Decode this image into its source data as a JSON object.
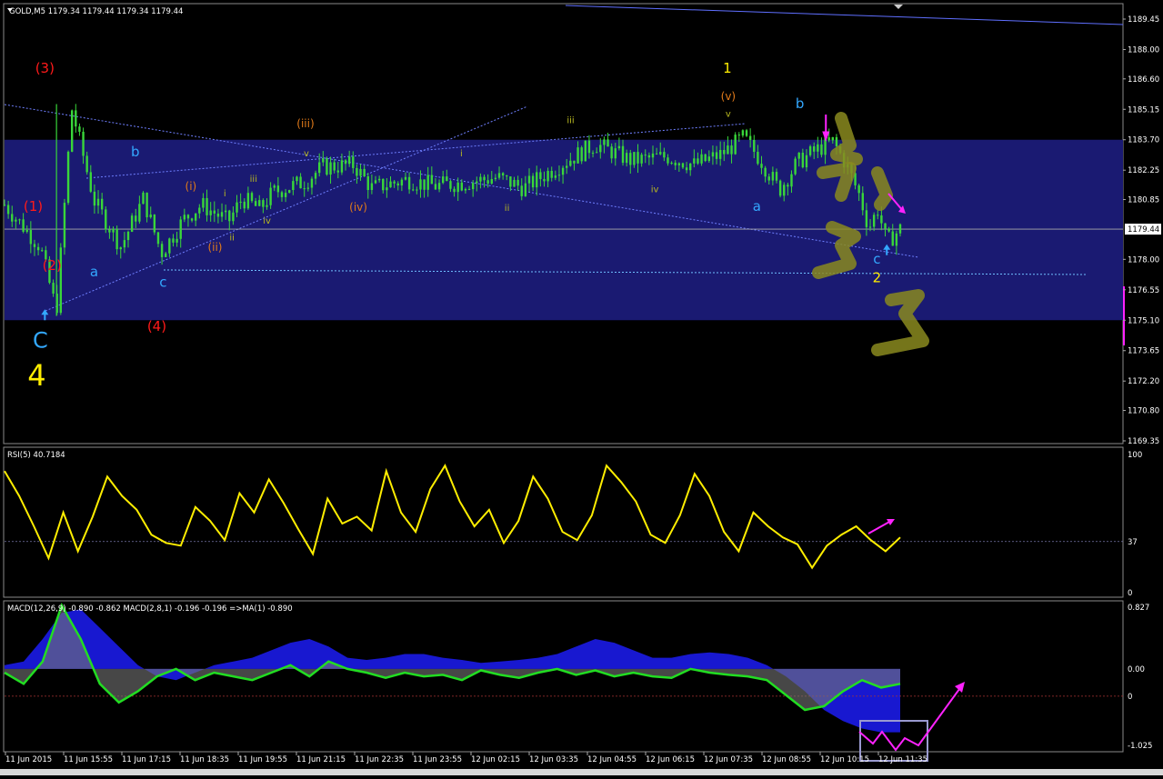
{
  "window": {
    "symbol_header": "GOLD,M5  1179.34 1179.44 1179.34 1179.44",
    "rsi_header": "RSI(5) 40.7184",
    "macd_header": "MACD(12,26,9) -0.890 -0.862  MACD(2,8,1) -0.196 -0.196  =>MA(1) -0.890"
  },
  "colors": {
    "background": "#000000",
    "zone": "#1a1a72",
    "candle": "#39d63a",
    "rsi": "#ffee00",
    "macd_hist": "#1818d0",
    "macd_hist_gray": "#777777",
    "macd_line": "#22dd22",
    "annotation_magenta": "#ff22ff",
    "label_red": "#ff1a1a",
    "label_cyan": "#33a8ff",
    "label_yellow": "#ffee00",
    "label_orange": "#e07a1a",
    "label_olive": "#b8b820"
  },
  "chart_data": [
    {
      "type": "candlestick",
      "title": "GOLD,M5",
      "y_ticks": [
        "1189.45",
        "1188.00",
        "1186.60",
        "1185.15",
        "1183.70",
        "1182.25",
        "1180.85",
        "1179.44",
        "1178.00",
        "1176.55",
        "1175.10",
        "1173.65",
        "1172.20",
        "1170.80",
        "1169.35"
      ],
      "ylim": [
        1169.35,
        1189.45
      ],
      "current_price": "1179.44",
      "zone": [
        1175.1,
        1183.7
      ],
      "close_path": [
        {
          "t": 0,
          "y": 1180.6
        },
        {
          "t": 0.04,
          "y": 1178.6
        },
        {
          "t": 0.058,
          "y": 1175.5
        },
        {
          "t": 0.075,
          "y": 1185.2
        },
        {
          "t": 0.1,
          "y": 1180.8
        },
        {
          "t": 0.13,
          "y": 1178.6
        },
        {
          "t": 0.155,
          "y": 1180.9
        },
        {
          "t": 0.175,
          "y": 1178.3
        },
        {
          "t": 0.2,
          "y": 1179.9
        },
        {
          "t": 0.22,
          "y": 1180.6
        },
        {
          "t": 0.25,
          "y": 1179.8
        },
        {
          "t": 0.265,
          "y": 1180.9
        },
        {
          "t": 0.285,
          "y": 1180.4
        },
        {
          "t": 0.3,
          "y": 1181.2
        },
        {
          "t": 0.335,
          "y": 1181.7
        },
        {
          "t": 0.355,
          "y": 1182.4
        },
        {
          "t": 0.39,
          "y": 1182.5
        },
        {
          "t": 0.41,
          "y": 1181.4
        },
        {
          "t": 0.45,
          "y": 1181.8
        },
        {
          "t": 0.48,
          "y": 1181.5
        },
        {
          "t": 0.52,
          "y": 1181.7
        },
        {
          "t": 0.55,
          "y": 1181.9
        },
        {
          "t": 0.58,
          "y": 1181.4
        },
        {
          "t": 0.62,
          "y": 1182.5
        },
        {
          "t": 0.66,
          "y": 1183.5
        },
        {
          "t": 0.7,
          "y": 1182.7
        },
        {
          "t": 0.74,
          "y": 1182.9
        },
        {
          "t": 0.77,
          "y": 1182.5
        },
        {
          "t": 0.8,
          "y": 1183.0
        },
        {
          "t": 0.825,
          "y": 1183.8
        },
        {
          "t": 0.845,
          "y": 1182.7
        },
        {
          "t": 0.865,
          "y": 1181.3
        },
        {
          "t": 0.885,
          "y": 1182.6
        },
        {
          "t": 0.91,
          "y": 1183.3
        },
        {
          "t": 0.925,
          "y": 1183.6
        },
        {
          "t": 0.94,
          "y": 1182.5
        },
        {
          "t": 0.955,
          "y": 1181.0
        },
        {
          "t": 0.965,
          "y": 1179.5
        },
        {
          "t": 0.975,
          "y": 1180.4
        },
        {
          "t": 0.985,
          "y": 1178.8
        },
        {
          "t": 1.0,
          "y": 1179.44
        }
      ],
      "elliott_labels": [
        {
          "text": "(3)",
          "t": 0.045,
          "price": 1186.9,
          "color": "label_red",
          "size": "wave-lbl"
        },
        {
          "text": "(1)",
          "t": 0.032,
          "price": 1180.3,
          "color": "label_red",
          "size": "wave-lbl"
        },
        {
          "text": "(2)",
          "t": 0.053,
          "price": 1177.5,
          "color": "label_red",
          "size": "wave-lbl"
        },
        {
          "text": "(4)",
          "t": 0.17,
          "price": 1174.6,
          "color": "label_red",
          "size": "wave-lbl"
        },
        {
          "text": "C",
          "t": 0.04,
          "price": 1173.8,
          "color": "label_cyan",
          "size": "wave-xl"
        },
        {
          "text": "4",
          "t": 0.036,
          "price": 1172.0,
          "color": "label_yellow",
          "size": "wave-xxl"
        },
        {
          "text": "b",
          "t": 0.146,
          "price": 1182.9,
          "color": "label_cyan",
          "size": "wave-lbl"
        },
        {
          "text": "a",
          "t": 0.1,
          "price": 1177.2,
          "color": "label_cyan",
          "size": "wave-lbl"
        },
        {
          "text": "c",
          "t": 0.177,
          "price": 1176.7,
          "color": "label_cyan",
          "size": "wave-lbl"
        },
        {
          "text": "(i)",
          "t": 0.208,
          "price": 1181.3,
          "color": "label_orange",
          "size": "wave-sm"
        },
        {
          "text": "(ii)",
          "t": 0.235,
          "price": 1178.4,
          "color": "label_orange",
          "size": "wave-sm"
        },
        {
          "text": "(iii)",
          "t": 0.336,
          "price": 1184.3,
          "color": "label_orange",
          "size": "wave-sm"
        },
        {
          "text": "(iv)",
          "t": 0.395,
          "price": 1180.3,
          "color": "label_orange",
          "size": "wave-sm"
        },
        {
          "text": "(v)",
          "t": 0.808,
          "price": 1185.6,
          "color": "label_orange",
          "size": "wave-sm"
        },
        {
          "text": "1",
          "t": 0.807,
          "price": 1186.9,
          "color": "label_yellow",
          "size": "wave-lbl"
        },
        {
          "text": "i",
          "t": 0.246,
          "price": 1181.0,
          "color": "label_olive",
          "size": "wave-xs"
        },
        {
          "text": "ii",
          "t": 0.254,
          "price": 1178.9,
          "color": "label_olive",
          "size": "wave-xs"
        },
        {
          "text": "iii",
          "t": 0.278,
          "price": 1181.7,
          "color": "label_olive",
          "size": "wave-xs"
        },
        {
          "text": "iv",
          "t": 0.293,
          "price": 1179.7,
          "color": "label_olive",
          "size": "wave-xs"
        },
        {
          "text": "v",
          "t": 0.337,
          "price": 1182.9,
          "color": "label_olive",
          "size": "wave-xs"
        },
        {
          "text": "i",
          "t": 0.51,
          "price": 1182.9,
          "color": "label_olive",
          "size": "wave-xs"
        },
        {
          "text": "ii",
          "t": 0.561,
          "price": 1180.3,
          "color": "label_olive",
          "size": "wave-xs"
        },
        {
          "text": "iii",
          "t": 0.632,
          "price": 1184.5,
          "color": "label_olive",
          "size": "wave-xs"
        },
        {
          "text": "iv",
          "t": 0.726,
          "price": 1181.2,
          "color": "label_olive",
          "size": "wave-xs"
        },
        {
          "text": "v",
          "t": 0.808,
          "price": 1184.8,
          "color": "label_olive",
          "size": "wave-xs"
        },
        {
          "text": "b",
          "t": 0.888,
          "price": 1185.2,
          "color": "label_cyan",
          "size": "wave-lbl"
        },
        {
          "text": "a",
          "t": 0.84,
          "price": 1180.3,
          "color": "label_cyan",
          "size": "wave-lbl"
        },
        {
          "text": "c",
          "t": 0.974,
          "price": 1177.8,
          "color": "label_cyan",
          "size": "wave-lbl"
        },
        {
          "text": "2",
          "t": 0.974,
          "price": 1176.9,
          "color": "label_yellow",
          "size": "wave-lbl"
        }
      ]
    },
    {
      "type": "line",
      "title": "RSI(5) 40.7184",
      "y_ticks": [
        "100",
        "37",
        "0"
      ],
      "ylim": [
        0,
        100
      ],
      "level": 37,
      "series": [
        {
          "values": [
            88,
            70,
            48,
            25,
            58,
            30,
            55,
            84,
            70,
            60,
            42,
            36,
            34,
            62,
            52,
            38,
            72,
            58,
            82,
            65,
            46,
            28,
            68,
            50,
            55,
            45,
            88,
            58,
            44,
            75,
            92,
            66,
            48,
            60,
            36,
            52,
            84,
            68,
            44,
            38,
            56,
            92,
            80,
            66,
            42,
            36,
            56,
            86,
            70,
            44,
            30,
            58,
            48,
            40,
            35,
            18,
            34,
            42,
            48,
            38,
            30,
            40
          ]
        }
      ]
    },
    {
      "type": "line",
      "title": "MACD(12,26,9) -0.890 -0.862  MACD(2,8,1) -0.196 -0.196  =>MA(1) -0.890",
      "y_ticks": [
        "0.827",
        "0.00",
        "0",
        "-1.025"
      ],
      "ylim": [
        -1.025,
        0.827
      ],
      "hist": [
        0.05,
        0.1,
        0.4,
        0.75,
        0.8,
        0.55,
        0.3,
        0.05,
        -0.1,
        -0.15,
        -0.05,
        0.05,
        0.1,
        0.15,
        0.25,
        0.35,
        0.4,
        0.3,
        0.15,
        0.12,
        0.15,
        0.2,
        0.2,
        0.15,
        0.12,
        0.08,
        0.1,
        0.12,
        0.15,
        0.2,
        0.3,
        0.4,
        0.35,
        0.25,
        0.15,
        0.15,
        0.2,
        0.22,
        0.2,
        0.15,
        0.05,
        -0.1,
        -0.3,
        -0.55,
        -0.7,
        -0.8,
        -0.85,
        -0.85
      ],
      "signal_line": [
        -0.05,
        -0.2,
        0.1,
        0.85,
        0.4,
        -0.2,
        -0.45,
        -0.3,
        -0.1,
        0.0,
        -0.15,
        -0.05,
        -0.1,
        -0.15,
        -0.05,
        0.05,
        -0.1,
        0.1,
        0.0,
        -0.05,
        -0.12,
        -0.05,
        -0.1,
        -0.08,
        -0.15,
        -0.02,
        -0.08,
        -0.12,
        -0.05,
        0.0,
        -0.08,
        -0.02,
        -0.1,
        -0.05,
        -0.1,
        -0.12,
        0.0,
        -0.05,
        -0.08,
        -0.1,
        -0.15,
        -0.35,
        -0.55,
        -0.5,
        -0.3,
        -0.15,
        -0.25,
        -0.2
      ]
    }
  ],
  "x_labels": [
    "11 Jun 2015",
    "11 Jun 15:55",
    "11 Jun 17:15",
    "11 Jun 18:35",
    "11 Jun 19:55",
    "11 Jun 21:15",
    "11 Jun 22:35",
    "11 Jun 23:55",
    "12 Jun 02:15",
    "12 Jun 03:35",
    "12 Jun 04:55",
    "12 Jun 06:15",
    "12 Jun 07:35",
    "12 Jun 08:55",
    "12 Jun 10:15",
    "12 Jun 11:35"
  ]
}
